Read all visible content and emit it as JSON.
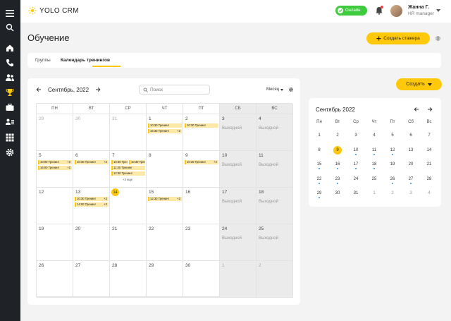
{
  "brand": {
    "name": "YOLO CRM",
    "accent": "#ffc80a",
    "sidebar_bg": "#1f2226"
  },
  "topbar": {
    "status": "Онлайн",
    "status_color": "#3ecb3e",
    "user_name": "Жанна Г.",
    "user_role": "HR manager"
  },
  "sidebar": {
    "icons": [
      "menu-icon",
      "search-icon",
      "home-icon",
      "phone-icon",
      "users-icon",
      "trophy-icon",
      "briefcase-icon",
      "user-list-icon",
      "grid-icon",
      "gear-icon"
    ]
  },
  "page": {
    "title": "Обучение",
    "create_trainee_label": "Создать стажера"
  },
  "tabs": [
    {
      "label": "Группы"
    },
    {
      "label": "Календарь тренингов"
    }
  ],
  "create_button": {
    "label": "Создать"
  },
  "calendar": {
    "month_label": "Сентябрь, 2022",
    "search_placeholder": "Поиск",
    "view_label": "Месяц",
    "weekday_headers": [
      "ПН",
      "ВТ",
      "СР",
      "ЧТ",
      "ПТ",
      "СБ",
      "ВС"
    ],
    "weekend_label": "Выходной",
    "more_label": "+3 еще",
    "weeks": [
      [
        {
          "d": "29",
          "m": true
        },
        {
          "d": "30",
          "m": true
        },
        {
          "d": "31",
          "m": true
        },
        {
          "d": "1"
        },
        {
          "d": "2"
        },
        {
          "d": "3",
          "w": true
        },
        {
          "d": "4",
          "w": true
        }
      ],
      [
        {
          "d": "5"
        },
        {
          "d": "6"
        },
        {
          "d": "7"
        },
        {
          "d": "8"
        },
        {
          "d": "9"
        },
        {
          "d": "10",
          "w": true
        },
        {
          "d": "11",
          "w": true
        }
      ],
      [
        {
          "d": "12"
        },
        {
          "d": "13"
        },
        {
          "d": "14",
          "today": true
        },
        {
          "d": "15"
        },
        {
          "d": "16"
        },
        {
          "d": "17",
          "w": true
        },
        {
          "d": "18",
          "w": true
        }
      ],
      [
        {
          "d": "19"
        },
        {
          "d": "20"
        },
        {
          "d": "21"
        },
        {
          "d": "22"
        },
        {
          "d": "23"
        },
        {
          "d": "24",
          "w": true
        },
        {
          "d": "25",
          "w": true
        }
      ],
      [
        {
          "d": "26"
        },
        {
          "d": "27"
        },
        {
          "d": "28"
        },
        {
          "d": "29"
        },
        {
          "d": "30"
        },
        {
          "d": "1",
          "w": true,
          "m": true
        },
        {
          "d": "2",
          "w": true,
          "m": true
        }
      ]
    ],
    "events": {
      "0-3": [
        {
          "t": "10:30 Тренинг"
        },
        {
          "t": "16:30 Тренинг",
          "p": "+2"
        }
      ],
      "0-4": [
        {
          "t": "10:30 Тренинг"
        }
      ],
      "1-0": [
        {
          "t": "10:00 Тренинг",
          "p": "+2"
        },
        {
          "t": "16:00 Тренинг",
          "p": "+2"
        }
      ],
      "1-1": [
        {
          "t": "10:30 Тренинг",
          "p": "+2"
        }
      ],
      "1-2": [
        {
          "t": "10:30 Тренинг",
          "half": "a"
        },
        {
          "t": "10:30 Тренинг",
          "half": "b"
        },
        {
          "t": "11:30 Тренинг"
        },
        {
          "t": "12:30 Тренинг"
        }
      ],
      "1-4": [
        {
          "t": "10:30 Тренинг",
          "p": "+2"
        }
      ],
      "2-1": [
        {
          "t": "10:30 Тренинг",
          "p": "+2"
        },
        {
          "t": "14:00 Тренинг",
          "p": "+2"
        }
      ],
      "2-3": [
        {
          "t": "12:30 Тренинг",
          "p": "+2"
        }
      ]
    }
  },
  "mini": {
    "title": "Сентябрь 2022",
    "weekdays": [
      "Пн",
      "Вт",
      "Ср",
      "Чт",
      "Пт",
      "Сб",
      "Вс"
    ],
    "weeks": [
      [
        {
          "d": "1"
        },
        {
          "d": "2"
        },
        {
          "d": "3"
        },
        {
          "d": "4"
        },
        {
          "d": "5"
        },
        {
          "d": "6"
        },
        {
          "d": "7"
        }
      ],
      [
        {
          "d": "8"
        },
        {
          "d": "9",
          "sel": true
        },
        {
          "d": "10",
          "dot": true
        },
        {
          "d": "11",
          "dot": true
        },
        {
          "d": "12",
          "dot": true
        },
        {
          "d": "13"
        },
        {
          "d": "14"
        }
      ],
      [
        {
          "d": "15",
          "dot": true
        },
        {
          "d": "16",
          "dot": true
        },
        {
          "d": "17",
          "dot": true
        },
        {
          "d": "18",
          "dot": true
        },
        {
          "d": "19"
        },
        {
          "d": "20"
        },
        {
          "d": "21"
        }
      ],
      [
        {
          "d": "22",
          "dot": true
        },
        {
          "d": "23",
          "dot": true
        },
        {
          "d": "24"
        },
        {
          "d": "25"
        },
        {
          "d": "26",
          "dot": true
        },
        {
          "d": "27",
          "dot": true
        },
        {
          "d": "28"
        }
      ],
      [
        {
          "d": "29",
          "dot": true
        },
        {
          "d": "30"
        },
        {
          "d": "31"
        },
        {
          "d": "1",
          "m": true
        },
        {
          "d": "2",
          "m": true
        },
        {
          "d": "3",
          "m": true
        },
        {
          "d": "4",
          "m": true
        }
      ]
    ]
  }
}
